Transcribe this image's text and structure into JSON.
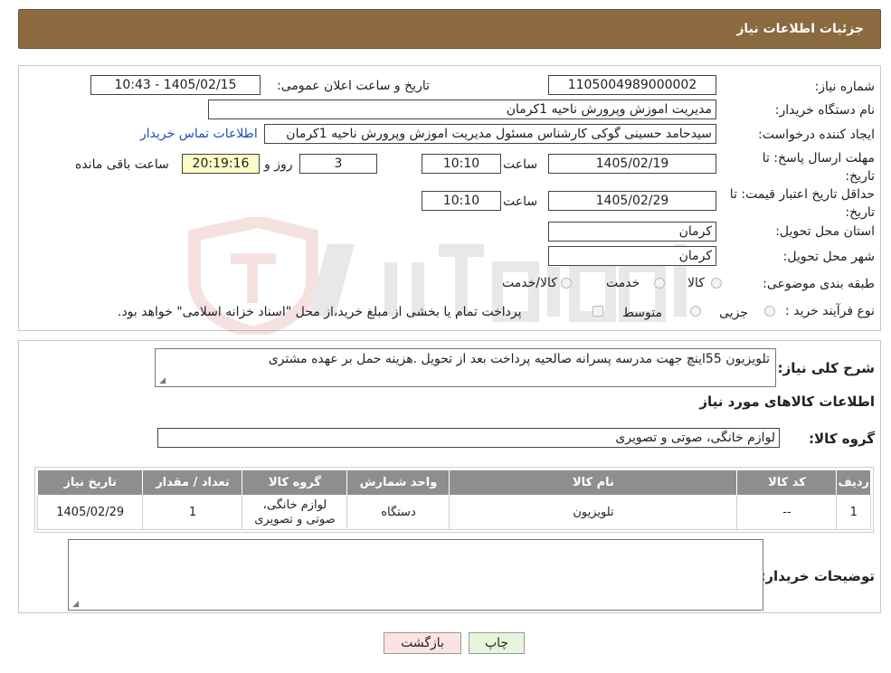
{
  "header": {
    "title": "جزئیات اطلاعات نیاز"
  },
  "info": {
    "need_number_label": "شماره نیاز:",
    "need_number": "1105004989000002",
    "announce_label": "تاریخ و ساعت اعلان عمومی:",
    "announce_value": "1405/02/15 - 10:43",
    "buyer_org_label": "نام دستگاه خریدار:",
    "buyer_org": "مدیریت اموزش وپرورش ناحیه 1کرمان",
    "creator_label": "ایجاد کننده درخواست:",
    "creator": "سیدحامد حسینی گوکی کارشناس مسئول مدیریت اموزش وپرورش ناحیه 1کرمان",
    "contact_link": "اطلاعات تماس خریدار",
    "deadline_label_1": "مهلت ارسال پاسخ: تا",
    "deadline_label_2": "تاریخ:",
    "deadline_date": "1405/02/19",
    "time_label": "ساعت",
    "deadline_time": "10:10",
    "days_value": "3",
    "days_label": "روز و",
    "remaining_time": "20:19:16",
    "remaining_label": "ساعت باقی مانده",
    "validity_label_1": "حداقل تاریخ اعتبار قیمت: تا",
    "validity_label_2": "تاریخ:",
    "validity_date": "1405/02/29",
    "validity_time": "10:10",
    "province_label": "استان محل تحویل:",
    "province": "کرمان",
    "city_label": "شهر محل تحویل:",
    "city": "کرمان",
    "category_label": "طبقه بندی موضوعی:",
    "category_options": [
      "کالا",
      "خدمت",
      "کالا/خدمت"
    ],
    "process_label": "نوع فرآیند خرید :",
    "process_options": [
      "جزیی",
      "متوسط"
    ],
    "process_note": "پرداخت تمام یا بخشی از مبلغ خرید،از محل \"اسناد خزانه اسلامی\" خواهد بود."
  },
  "description": {
    "label": "شرح کلی نیاز:",
    "value": "تلویزیون 55اینچ جهت مدرسه پسرانه صالحیه پرداخت بعد از تحویل .هزینه حمل بر عهده مشتری"
  },
  "goods": {
    "section_title": "اطلاعات کالاهای مورد نیاز",
    "group_label": "گروه کالا:",
    "group_value": "لوازم خانگی، صوتی و تصویری",
    "columns": [
      "ردیف",
      "کد کالا",
      "نام کالا",
      "واحد شمارش",
      "گروه کالا",
      "تعداد / مقدار",
      "تاریخ نیاز"
    ],
    "rows": [
      [
        "1",
        "--",
        "تلویزیون",
        "دستگاه",
        "لوازم خانگی، صوتی و تصویری",
        "1",
        "1405/02/29"
      ]
    ]
  },
  "buyer_notes": {
    "label": "توضیحات خریدار:",
    "value": ""
  },
  "buttons": {
    "print": "چاپ",
    "back": "بازگشت"
  },
  "colors": {
    "header": "#8b6a3f",
    "table_header": "#8e8e8e",
    "print_btn": "#e6f6dc",
    "back_btn": "#fbe3e3"
  }
}
